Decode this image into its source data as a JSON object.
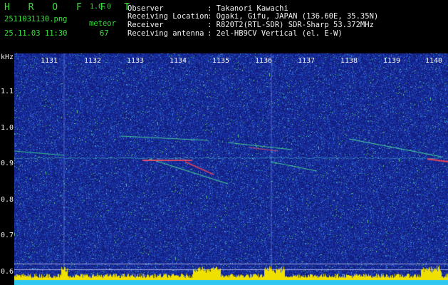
{
  "header": {
    "logo": "H R O F F T",
    "version": "1.0.0",
    "filename": "2511031130.png",
    "mode": "meteor",
    "datetime": "25.11.03 11:30",
    "count": "67",
    "observer_label": "Observer",
    "observer_value": ": Takanori Kawachi",
    "location_label": "Receiving Location",
    "location_value": ": Ogaki, Gifu, JAPAN (136.60E, 35.35N)",
    "receiver_label": "Receiver",
    "receiver_value": ": R820T2(RTL-SDR) SDR-Sharp 53.372MHz",
    "antenna_label": "Receiving antenna",
    "antenna_value": ": 2el-HB9CV Vertical (el. E-W)"
  },
  "axis": {
    "unit": "kHz",
    "y_labels": [
      "1.1",
      "1.0",
      "0.9",
      "0.8",
      "0.7",
      "0.6"
    ],
    "time_labels": [
      "1131",
      "1132",
      "1133",
      "1134",
      "1135",
      "1136",
      "1137",
      "1138",
      "1139",
      "1140"
    ]
  },
  "colors": {
    "background": "#1a2a9a",
    "header_green": "#38e03a",
    "header_white": "#f2f2f2",
    "echo_green": "#40ff60",
    "echo_red": "#ff3040",
    "spectrum_yellow": "#f0e000",
    "spectrum_cyan": "#30c8f0"
  }
}
